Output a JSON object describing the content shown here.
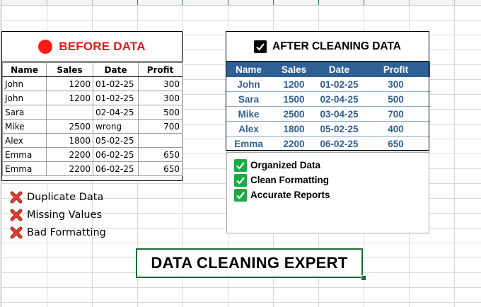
{
  "before": {
    "title": "BEFORE DATA",
    "dot_color": "#ff1a1a",
    "title_color": "#e21a1a",
    "columns": [
      "Name",
      "Sales",
      "Date",
      "Profit"
    ],
    "rows": [
      [
        "John",
        "1200",
        "01-02-25",
        "300"
      ],
      [
        "John",
        "1200",
        "01-02-25",
        "300"
      ],
      [
        "Sara",
        "",
        "02-04-25",
        "500"
      ],
      [
        "Mike",
        "2500",
        "wrong",
        "700"
      ],
      [
        "Alex",
        "1800",
        "05-02-25",
        ""
      ],
      [
        "Emma",
        "2200",
        "06-02-25",
        "650"
      ],
      [
        "Emma",
        "2200",
        "06-02-25",
        "650"
      ]
    ],
    "issues": [
      "Duplicate Data",
      "Missing Values",
      "Bad Formatting"
    ],
    "issue_icon": "red-x-icon"
  },
  "after": {
    "title": "AFTER CLEANING DATA",
    "header_icon": "black-checkbox-icon",
    "header_color": "#2e6096",
    "text_color": "#2e5e94",
    "columns": [
      "Name",
      "Sales",
      "Date",
      "Profit"
    ],
    "rows": [
      [
        "John",
        "1200",
        "01-02-25",
        "300"
      ],
      [
        "Sara",
        "1500",
        "02-04-25",
        "500"
      ],
      [
        "Mike",
        "2500",
        "03-04-25",
        "700"
      ],
      [
        "Alex",
        "1800",
        "05-02-25",
        "400"
      ],
      [
        "Emma",
        "2200",
        "06-02-25",
        "650"
      ]
    ],
    "benefits": [
      "Organized Data",
      "Clean Formatting",
      "Accurate Reports"
    ],
    "benefit_icon": "green-checkbox-icon",
    "benefit_color": "#1fa845"
  },
  "banner": {
    "title": "DATA CLEANING EXPERT",
    "border_color": "#1f6d34"
  }
}
